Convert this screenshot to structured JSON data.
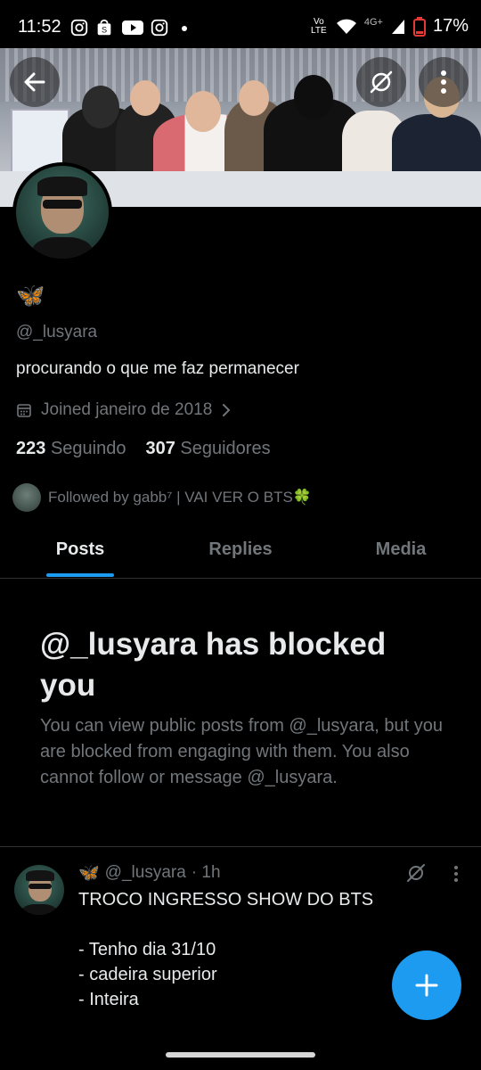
{
  "status_bar": {
    "time": "11:52",
    "network": "4G+",
    "volte": "Vo LTE",
    "battery": "17%"
  },
  "profile": {
    "display_name": "🦋",
    "handle": "@_lusyara",
    "bio": "procurando o que me faz permanecer",
    "joined": "Joined janeiro de 2018",
    "following_count": "223",
    "following_label": "Seguindo",
    "followers_count": "307",
    "followers_label": "Seguidores",
    "followed_by": "Followed by gabb⁷ | VAI VER O BTS🍀"
  },
  "tabs": [
    {
      "label": "Posts",
      "active": true
    },
    {
      "label": "Replies",
      "active": false
    },
    {
      "label": "Media",
      "active": false
    }
  ],
  "blocked": {
    "title": "@_lusyara has blocked you",
    "body": "You can view public posts from @_lusyara, but you are blocked from engaging with them. You also cannot follow or message @_lusyara."
  },
  "post": {
    "name": "🦋",
    "handle": "@_lusyara",
    "time": "· 1h",
    "text": "TROCO INGRESSO SHOW DO BTS\n\n- Tenho dia 31/10\n- cadeira superior\n- Inteira"
  },
  "icons": {
    "back": "back-arrow-icon",
    "grok": "grok-icon",
    "more": "more-vertical-icon",
    "calendar": "calendar-icon",
    "compose": "plus-icon"
  },
  "colors": {
    "accent": "#1d9bf0",
    "secondary_text": "#71767b",
    "background": "#000000"
  }
}
